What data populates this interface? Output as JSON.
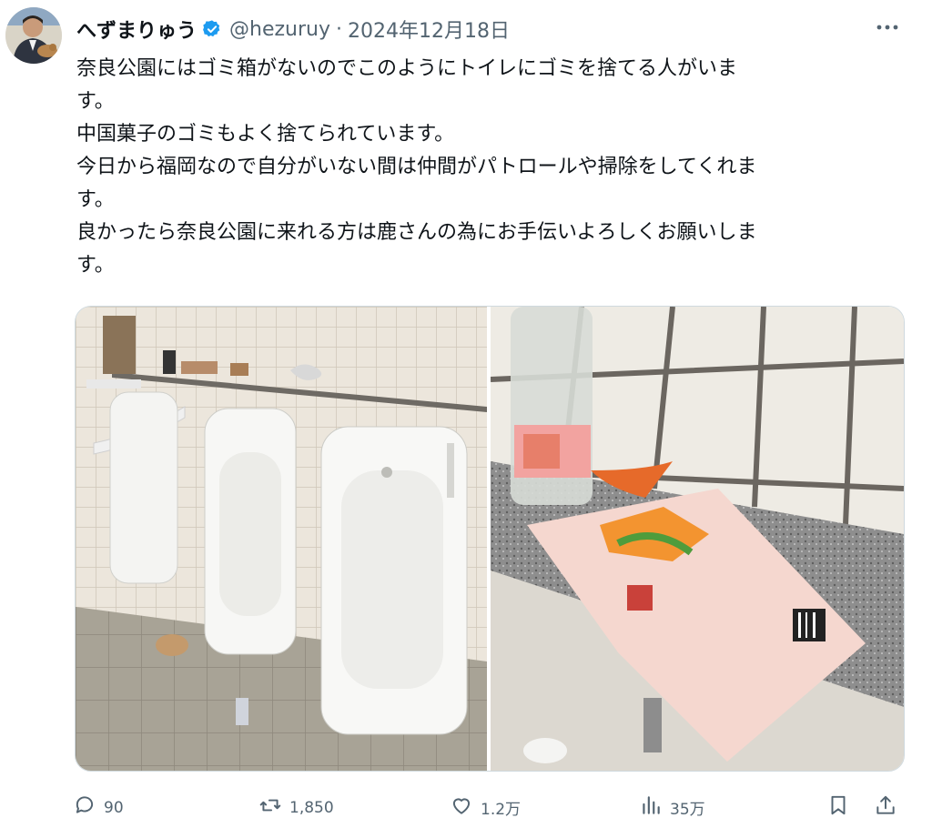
{
  "author": {
    "name": "へずまりゅう",
    "handle": "@hezuruy",
    "date": "2024年12月18日",
    "separator": "·"
  },
  "icons": {
    "verified": "verified-badge-icon",
    "more": "more-dots-icon",
    "reply": "reply-icon",
    "retweet": "retweet-icon",
    "like": "heart-icon",
    "views": "views-chart-icon",
    "bookmark": "bookmark-icon",
    "share": "share-icon"
  },
  "colors": {
    "verified": "#1d9bf0",
    "muted": "#536471",
    "text": "#0f1419"
  },
  "tweet": {
    "lines": [
      "奈良公園にはゴミ箱がないのでこのようにトイレにゴミを捨てる人がいま",
      "す。",
      "中国菓子のゴミもよく捨てられています。",
      "今日から福岡なので自分がいない間は仲間がパトロールや掃除をしてくれま",
      "す。",
      "良かったら奈良公園に来れる方は鹿さんの為にお手伝いよろしくお願いしま",
      "す。"
    ]
  },
  "actions": {
    "replies": "90",
    "retweets": "1,850",
    "likes": "1.2万",
    "views": "35万"
  }
}
